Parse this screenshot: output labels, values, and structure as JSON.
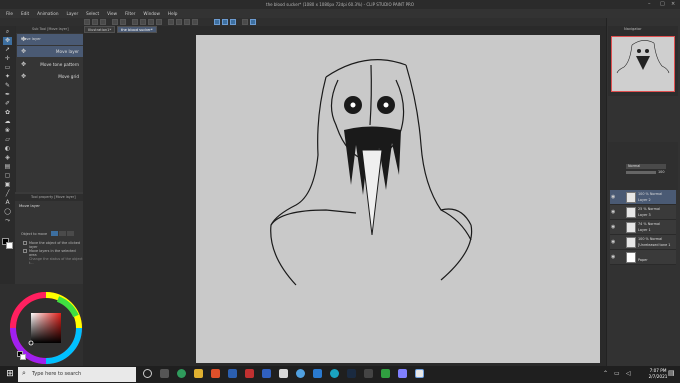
{
  "window": {
    "title": "the blood sucker* (1080 x 1080px 72dpi 60.3%) - CLIP STUDIO PAINT PRO"
  },
  "menu": [
    "File",
    "Edit",
    "Animation",
    "Layer",
    "Select",
    "View",
    "Filter",
    "Window",
    "Help"
  ],
  "canvas_tabs": [
    "Illustration1*",
    "the blood sucker*"
  ],
  "subtool": {
    "header": "Sub Tool [Move layer]",
    "items": [
      {
        "label": "Move layer"
      },
      {
        "label": "Move layer"
      },
      {
        "label": "Move tone pattern"
      },
      {
        "label": "Move grid"
      }
    ]
  },
  "tool_property": {
    "header": "Tool property [Move layer]",
    "title": "Move layer",
    "object_label": "Object to move",
    "options": [
      "Move the object of the clicked layer",
      "Move layers in the selected area",
      "Change the status of the object t..."
    ]
  },
  "color": {
    "main": "#000000",
    "sub": "#ffffff",
    "zoom_value": "250"
  },
  "navigator": {
    "title": "Navigator"
  },
  "layers": [
    {
      "line1": "100 % Normal",
      "line2": "Layer 2",
      "selected": true
    },
    {
      "line1": "25 % Normal",
      "line2": "Layer 3",
      "selected": false
    },
    {
      "line1": "74 % Normal",
      "line2": "Layer 1",
      "selected": false
    },
    {
      "line1": "100 % Normal",
      "line2": "[Unreleased tone 1",
      "selected": false
    },
    {
      "line1": "",
      "line2": "Paper",
      "selected": false
    }
  ],
  "layer_panel": {
    "blend": "Normal",
    "opacity": "100"
  },
  "taskbar": {
    "search_placeholder": "Type here to search",
    "time": "7:07 PM",
    "date": "2/7/2021"
  }
}
